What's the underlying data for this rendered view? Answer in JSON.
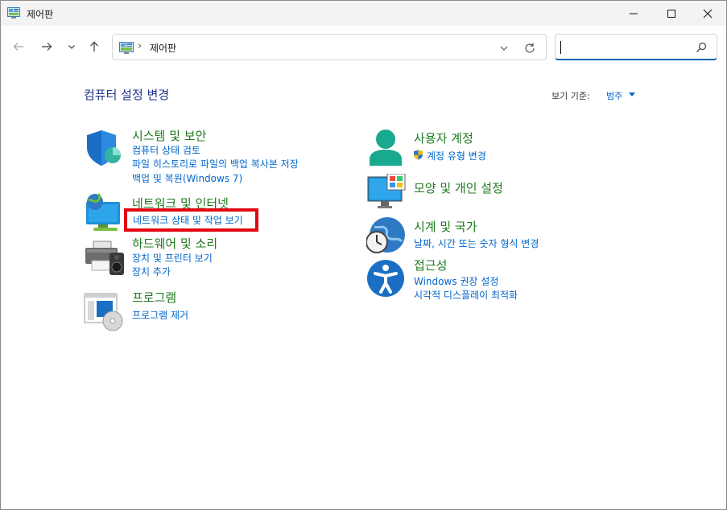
{
  "window": {
    "title": "제어판"
  },
  "navbar": {
    "address": "제어판",
    "address_sep": "›",
    "search_placeholder": ""
  },
  "content": {
    "title": "컴퓨터 설정 변경",
    "viewby_label": "보기 기준:",
    "viewby_value": "범주"
  },
  "categories": {
    "system": {
      "title": "시스템 및 보안",
      "links": [
        "컴퓨터 상태 검토",
        "파일 히스토리로 파일의 백업 복사본 저장",
        "백업 및 복원(Windows 7)"
      ]
    },
    "network": {
      "title": "네트워크 및 인터넷",
      "links": [
        "네트워크 상태 및 작업 보기"
      ]
    },
    "hardware": {
      "title": "하드웨어 및 소리",
      "links": [
        "장치 및 프린터 보기",
        "장치 추가"
      ]
    },
    "programs": {
      "title": "프로그램",
      "links": [
        "프로그램 제거"
      ]
    },
    "users": {
      "title": "사용자 계정",
      "links": [
        "계정 유형 변경"
      ]
    },
    "appearance": {
      "title": "모양 및 개인 설정",
      "links": []
    },
    "clock": {
      "title": "시계 및 국가",
      "links": [
        "날짜, 시간 또는 숫자 형식 변경"
      ]
    },
    "access": {
      "title": "접근성",
      "links": [
        "Windows 권장 설정",
        "시각적 디스플레이 최적화"
      ]
    }
  },
  "colors": {
    "category_title": "#1f7a1f",
    "link": "#0066cc",
    "page_title": "#1e3287",
    "highlight": "#e30613"
  }
}
